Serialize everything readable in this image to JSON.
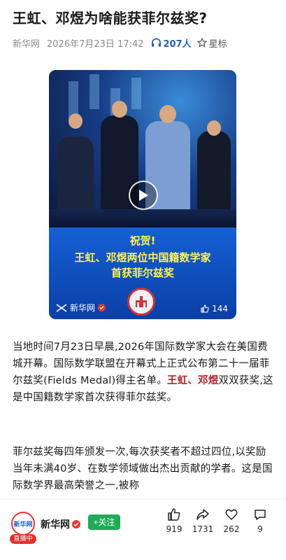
{
  "article": {
    "title": "王虹、邓煜为啥能获菲尔兹奖?",
    "source": "新华网",
    "datetime": "2026年7月23日 17:42",
    "listeners": "207人",
    "bookmark_label": "星标"
  },
  "video": {
    "banner_line1": "祝贺!",
    "banner_line2": "王虹、邓煜两位中国籍数学家",
    "banner_line3": "首获菲尔兹奖",
    "channel": "新华网",
    "likes": "144"
  },
  "body": {
    "p1_a": "当地时间7月23日早晨,2026年国际数学家大会在美国费城开幕。国际数学联盟在开幕式上正式公布第二十一届菲尔兹奖(Fields Medal)得主名单。",
    "p1_highlight": "王虹、邓煜",
    "p1_b": "双双获奖,这是中国籍数学家首次获得菲尔兹奖。",
    "p2": "菲尔兹奖每四年颁发一次,每次获奖者不超过四位,以奖励当年未满40岁、在数学领域做出杰出贡献的学者。这是国际数学界最高荣誉之一,被称"
  },
  "bottom": {
    "account_name": "新华网",
    "live_label": "直播中",
    "avatar_text": "新华网",
    "follow_label": "+关注",
    "like_count": "919",
    "share_count": "1731",
    "fav_count": "262",
    "comment_count": "9"
  },
  "colors": {
    "accent_blue": "#2a5db0",
    "highlight_red": "#b3242a",
    "follow_green": "#1faa58",
    "banner_yellow": "#fff25a"
  }
}
